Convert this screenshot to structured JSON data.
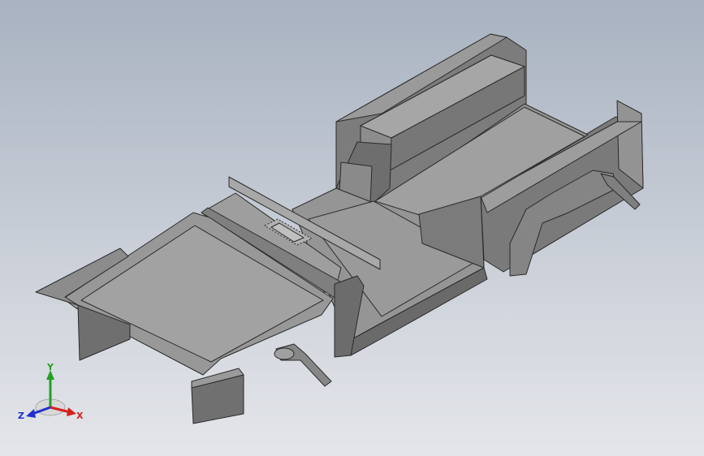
{
  "viewport": {
    "background_top": "#a8b2c0",
    "background_bottom": "#e4e6ea",
    "model": "sheet-metal-body-floor",
    "model_color": "#8a8a8a",
    "edge_color": "#2a2a2a"
  },
  "triad": {
    "x_label": "X",
    "y_label": "Y",
    "z_label": "Z",
    "x_color": "#d42020",
    "y_color": "#22a022",
    "z_color": "#2030d0"
  }
}
